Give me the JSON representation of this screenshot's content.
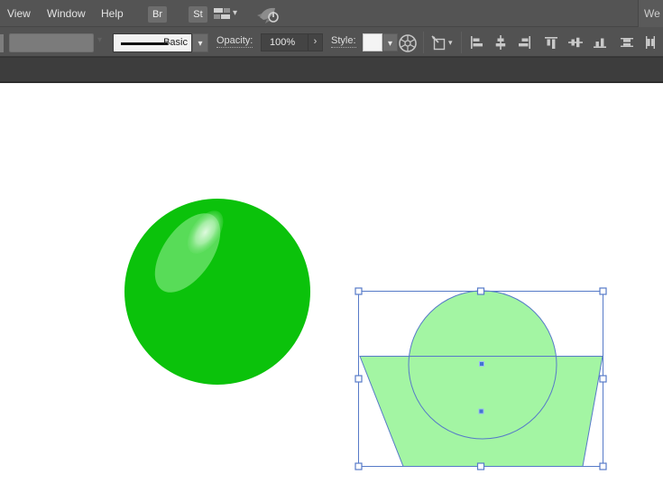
{
  "menu_bar": {
    "items": [
      "View",
      "Window",
      "Help"
    ],
    "bridge_button": "Br",
    "styles_button": "St",
    "workspace_button_partial": "We"
  },
  "control_bar": {
    "stroke_style_value": "Basic",
    "opacity_label": "Opacity:",
    "opacity_value": "100%",
    "style_label": "Style:"
  },
  "icons": {
    "chevron_down": "▾",
    "chevron_right": "›"
  },
  "colors": {
    "toolbar_bg": "#545454",
    "pasteboard_strip": "#3d3d3d",
    "ball_green": "#0bc20b",
    "ball_highlight_green": "#58dc58",
    "selected_fill_green": "#a3f5a3",
    "selection_blue": "#567ac8",
    "anchor_blue": "#4273d4"
  }
}
